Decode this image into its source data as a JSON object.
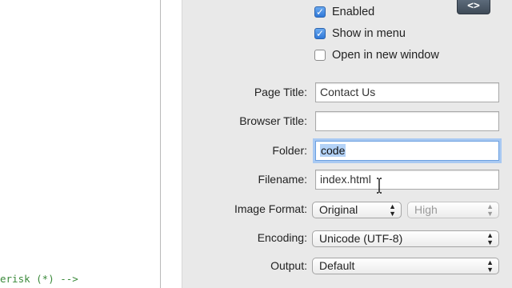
{
  "editor": {
    "code_comment": "erisk (*) -->"
  },
  "toolbar": {
    "code_view_glyph": "<>"
  },
  "checkboxes": [
    {
      "label": "Enabled",
      "checked": true
    },
    {
      "label": "Show in menu",
      "checked": true
    },
    {
      "label": "Open in new window",
      "checked": false
    }
  ],
  "form": {
    "page_title_label": "Page Title:",
    "page_title_value": "Contact Us",
    "browser_title_label": "Browser Title:",
    "browser_title_value": "",
    "folder_label": "Folder:",
    "folder_value": "code",
    "filename_label": "Filename:",
    "filename_value": "index.html",
    "image_format_label": "Image Format:",
    "image_format_value": "Original",
    "image_quality_value": "High",
    "encoding_label": "Encoding:",
    "encoding_value": "Unicode (UTF-8)",
    "output_label": "Output:",
    "output_value": "Default"
  },
  "colors": {
    "panel_bg": "#e9e9e9",
    "focus_ring": "#a8c9f2",
    "checkbox_blue": "#2f78d8",
    "comment_green": "#3b8a3b"
  }
}
